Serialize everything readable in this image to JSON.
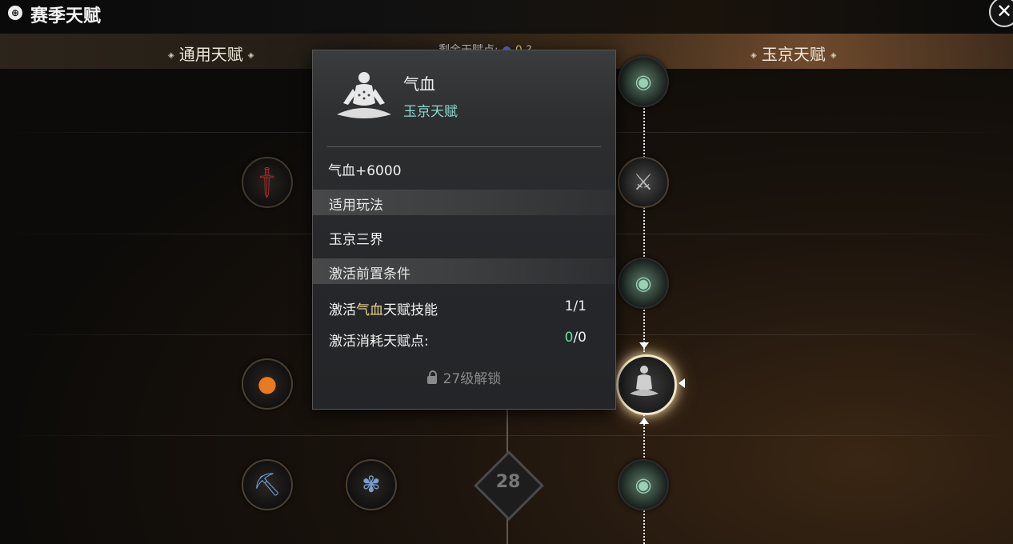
{
  "window": {
    "title": "赛季天赋",
    "close_label": "✕"
  },
  "tabs": [
    {
      "label": "通用天赋"
    },
    {
      "label": "玉京天赋"
    }
  ],
  "remaining_points": {
    "label": "剩余天赋点:",
    "value": "0",
    "info": "?"
  },
  "level_marker": {
    "value": "28"
  },
  "nodes": [
    {
      "name": "sword-talent-icon"
    },
    {
      "name": "shield-swords-talent-icon"
    },
    {
      "name": "fire-orb-talent-icon"
    },
    {
      "name": "pickaxe-talent-icon"
    },
    {
      "name": "grass-talent-icon"
    },
    {
      "name": "jade-orb-talent-icon"
    }
  ],
  "popup": {
    "icon": "meditating-figure-icon",
    "name": "气血",
    "type": "玉京天赋",
    "effect": "气血+6000",
    "mode_header": "适用玩法",
    "mode_value": "玉京三界",
    "prereq_header": "激活前置条件",
    "prereq_skill_prefix": "激活",
    "prereq_skill_highlight": "气血",
    "prereq_skill_suffix": "天赋技能",
    "prereq_skill_progress": "1/1",
    "cost_label": "激活消耗天赋点:",
    "cost_current": "0",
    "cost_total": "/0",
    "unlock_text": "27级解锁"
  },
  "colors": {
    "accent_teal": "#8fd8cf",
    "highlight_yellow": "#e8d68a",
    "ok_green": "#66e0a0"
  }
}
